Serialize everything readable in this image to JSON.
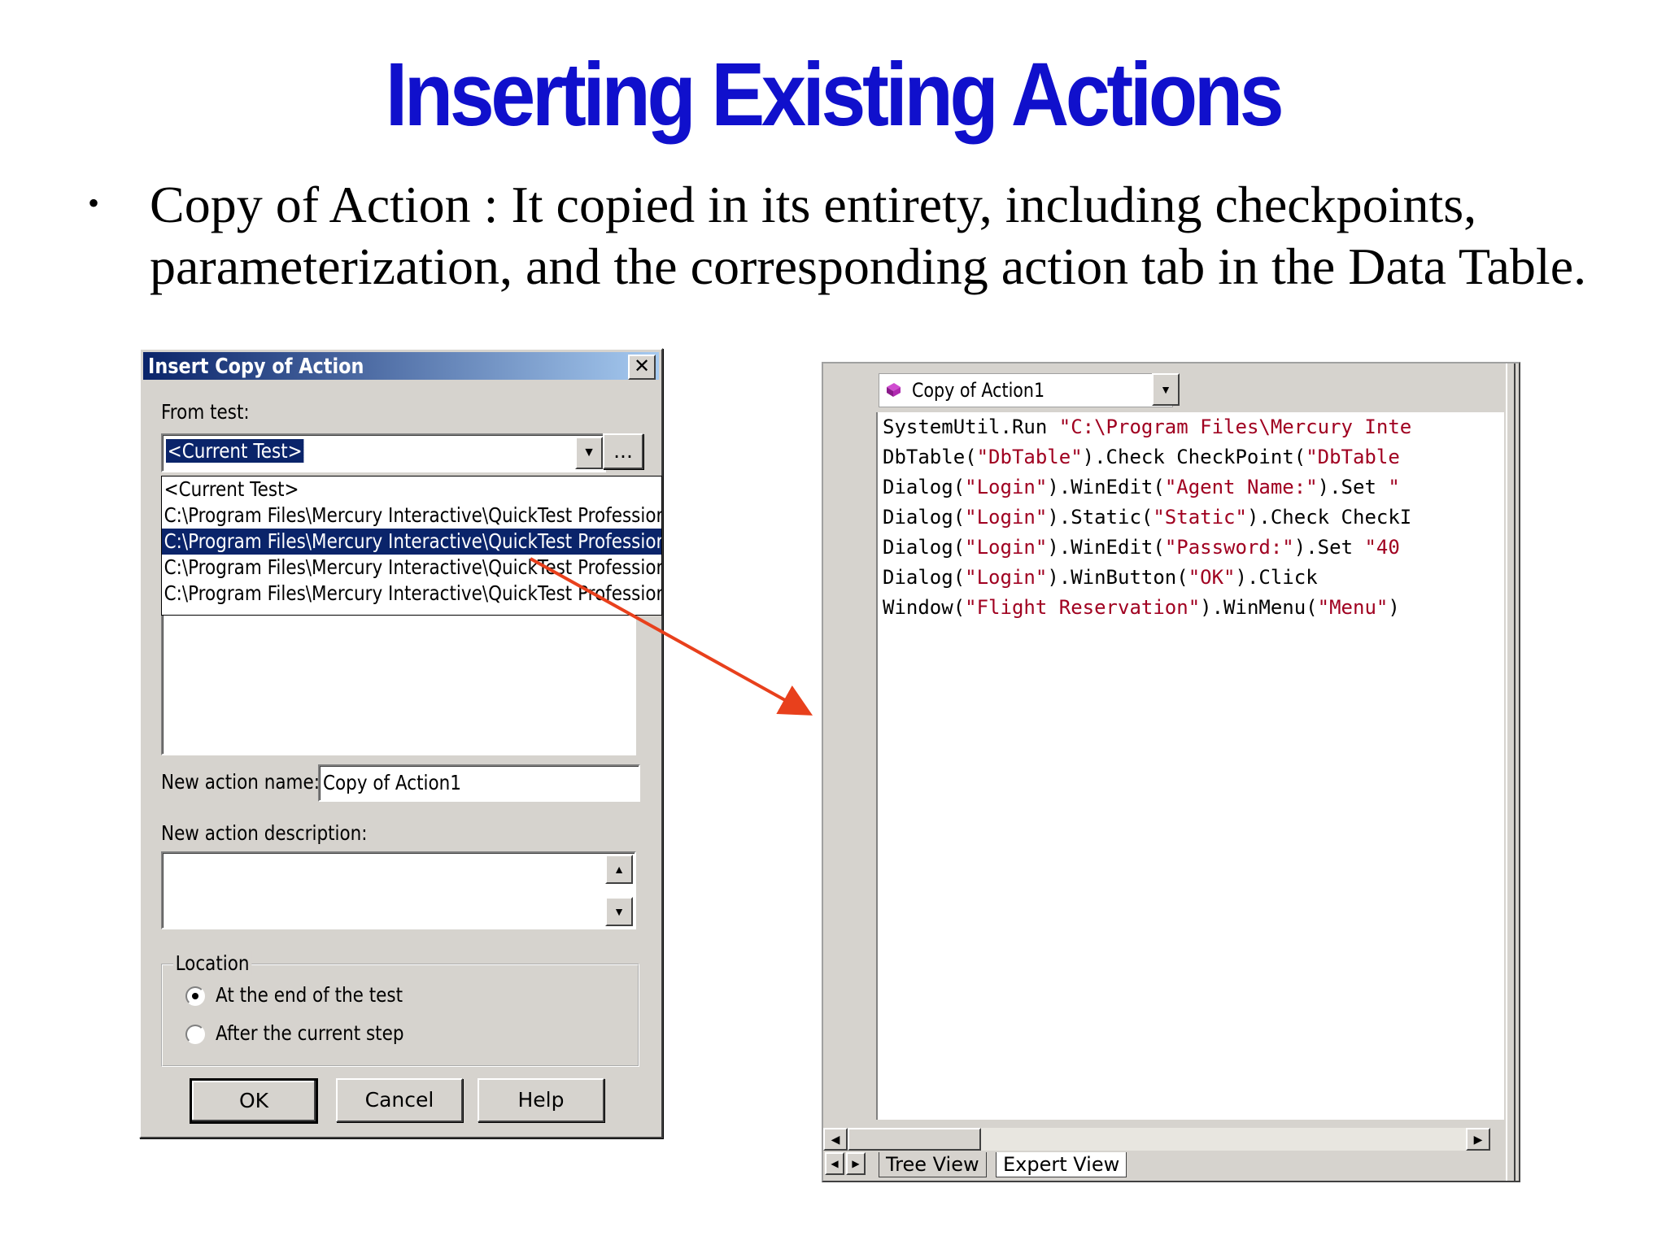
{
  "slide": {
    "title": "Inserting Existing Actions",
    "bullet": "Copy of Action : It copied in its entirety, including checkpoints, parameterization, and the corresponding action tab in the Data Table."
  },
  "dialog": {
    "title": "Insert Copy of Action",
    "close_label": "✕",
    "from_test_label": "From test:",
    "from_test_value": "<Current Test>",
    "browse_label": "...",
    "test_list": [
      "<Current Test>",
      "C:\\Program Files\\Mercury Interactive\\QuickTest Professiona",
      "C:\\Program Files\\Mercury Interactive\\QuickTest Professiona",
      "C:\\Program Files\\Mercury Interactive\\QuickTest Professiona",
      "C:\\Program Files\\Mercury Interactive\\QuickTest Professiona"
    ],
    "selected_index": 2,
    "new_action_name_label": "New action name:",
    "new_action_name_value": "Copy of Action1",
    "new_action_description_label": "New action description:",
    "new_action_description_value": "",
    "location_label": "Location",
    "location_options": [
      "At the end of the test",
      "After the current step"
    ],
    "location_selected": 0,
    "ok_label": "OK",
    "cancel_label": "Cancel",
    "help_label": "Help"
  },
  "editor": {
    "action_selector": "Copy of Action1",
    "code_lines": [
      "SystemUtil.Run \"C:\\Program Files\\Mercury Inte",
      "DbTable(\"DbTable\").Check CheckPoint(\"DbTable",
      "Dialog(\"Login\").WinEdit(\"Agent Name:\").Set \"",
      "Dialog(\"Login\").Static(\"Static\").Check CheckI",
      "Dialog(\"Login\").WinEdit(\"Password:\").Set \"40",
      "Dialog(\"Login\").WinButton(\"OK\").Click",
      "Window(\"Flight Reservation\").WinMenu(\"Menu\")"
    ],
    "tabs": [
      "Tree View",
      "Expert View"
    ],
    "active_tab": 1
  },
  "colors": {
    "title_blue": "#1010cc",
    "selection": "#0a246a",
    "code_string": "#a00020",
    "arrow": "#e8401c"
  }
}
